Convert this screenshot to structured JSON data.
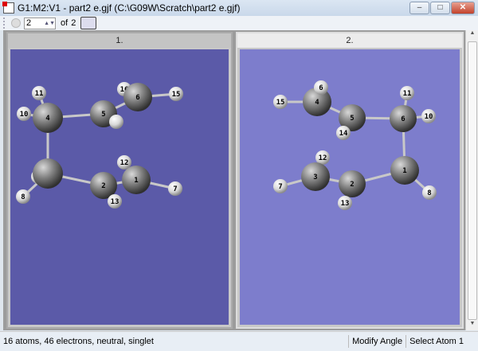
{
  "window": {
    "title": "G1:M2:V1 - part2 e.gjf (C:\\G09W\\Scratch\\part2 e.gjf)",
    "minimize": "–",
    "maximize": "□",
    "close": "✕"
  },
  "toolbar": {
    "frame_value": "2",
    "of_label": "of",
    "total": "2"
  },
  "panels": [
    {
      "label": "1.",
      "background": "#5b5aa8",
      "atom_labels": [
        "11",
        "10",
        "4",
        "5",
        "16",
        "6",
        "15",
        "9",
        "8",
        "2",
        "12",
        "1",
        "13",
        "7"
      ]
    },
    {
      "label": "2.",
      "background": "#7d7dcc",
      "atom_labels": [
        "15",
        "4",
        "6",
        "5",
        "14",
        "6",
        "11",
        "10",
        "12",
        "3",
        "7",
        "2",
        "13",
        "1",
        "8"
      ]
    }
  ],
  "status": {
    "info": "16 atoms, 46 electrons, neutral, singlet",
    "mode": "Modify Angle",
    "hint": "Select Atom 1"
  }
}
